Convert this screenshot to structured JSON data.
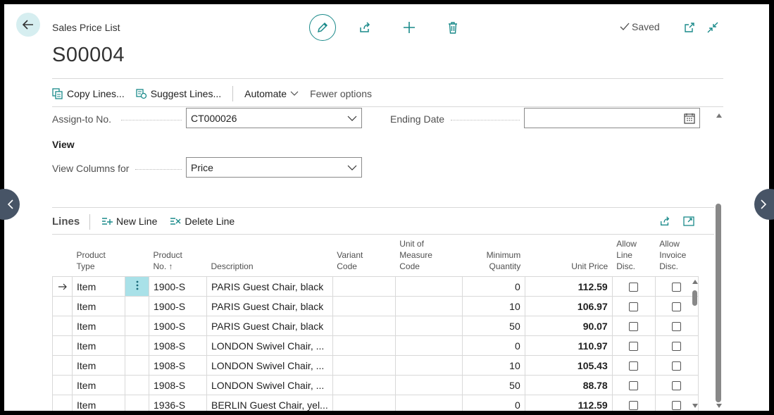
{
  "header": {
    "breadcrumb": "Sales Price List",
    "title": "S00004",
    "saved_label": "Saved"
  },
  "actions": {
    "copy_lines": "Copy Lines...",
    "suggest_lines": "Suggest Lines...",
    "automate": "Automate",
    "fewer_options": "Fewer options"
  },
  "form": {
    "assign_to_label": "Assign-to No.",
    "assign_to_value": "CT000026",
    "ending_date_label": "Ending Date",
    "ending_date_value": "",
    "view_section": "View",
    "view_columns_label": "View Columns for",
    "view_columns_value": "Price"
  },
  "lines": {
    "title": "Lines",
    "new_line": "New Line",
    "delete_line": "Delete Line",
    "columns": {
      "product_type_1": "Product",
      "product_type_2": "Type",
      "product_no_1": "Product",
      "product_no_2": "No. ↑",
      "description": "Description",
      "variant_1": "Variant",
      "variant_2": "Code",
      "uom_1": "Unit of",
      "uom_2": "Measure",
      "uom_3": "Code",
      "minqty_1": "Minimum",
      "minqty_2": "Quantity",
      "unit_price": "Unit Price",
      "line_disc_1": "Allow",
      "line_disc_2": "Line",
      "line_disc_3": "Disc.",
      "inv_disc_1": "Allow",
      "inv_disc_2": "Invoice",
      "inv_disc_3": "Disc."
    },
    "rows": [
      {
        "type": "Item",
        "no": "1900-S",
        "desc": "PARIS Guest Chair, black",
        "variant": "",
        "uom": "",
        "minqty": "0",
        "price": "112.59"
      },
      {
        "type": "Item",
        "no": "1900-S",
        "desc": "PARIS Guest Chair, black",
        "variant": "",
        "uom": "",
        "minqty": "10",
        "price": "106.97"
      },
      {
        "type": "Item",
        "no": "1900-S",
        "desc": "PARIS Guest Chair, black",
        "variant": "",
        "uom": "",
        "minqty": "50",
        "price": "90.07"
      },
      {
        "type": "Item",
        "no": "1908-S",
        "desc": "LONDON Swivel Chair, ...",
        "variant": "",
        "uom": "",
        "minqty": "0",
        "price": "110.97"
      },
      {
        "type": "Item",
        "no": "1908-S",
        "desc": "LONDON Swivel Chair, ...",
        "variant": "",
        "uom": "",
        "minqty": "10",
        "price": "105.43"
      },
      {
        "type": "Item",
        "no": "1908-S",
        "desc": "LONDON Swivel Chair, ...",
        "variant": "",
        "uom": "",
        "minqty": "50",
        "price": "88.78"
      },
      {
        "type": "Item",
        "no": "1936-S",
        "desc": "BERLIN Guest Chair, yel...",
        "variant": "",
        "uom": "",
        "minqty": "0",
        "price": "112.59"
      }
    ]
  },
  "colors": {
    "accent": "#1a8a8a",
    "menu_cell": "#a9e1e8",
    "nav_circle": "#475466"
  }
}
